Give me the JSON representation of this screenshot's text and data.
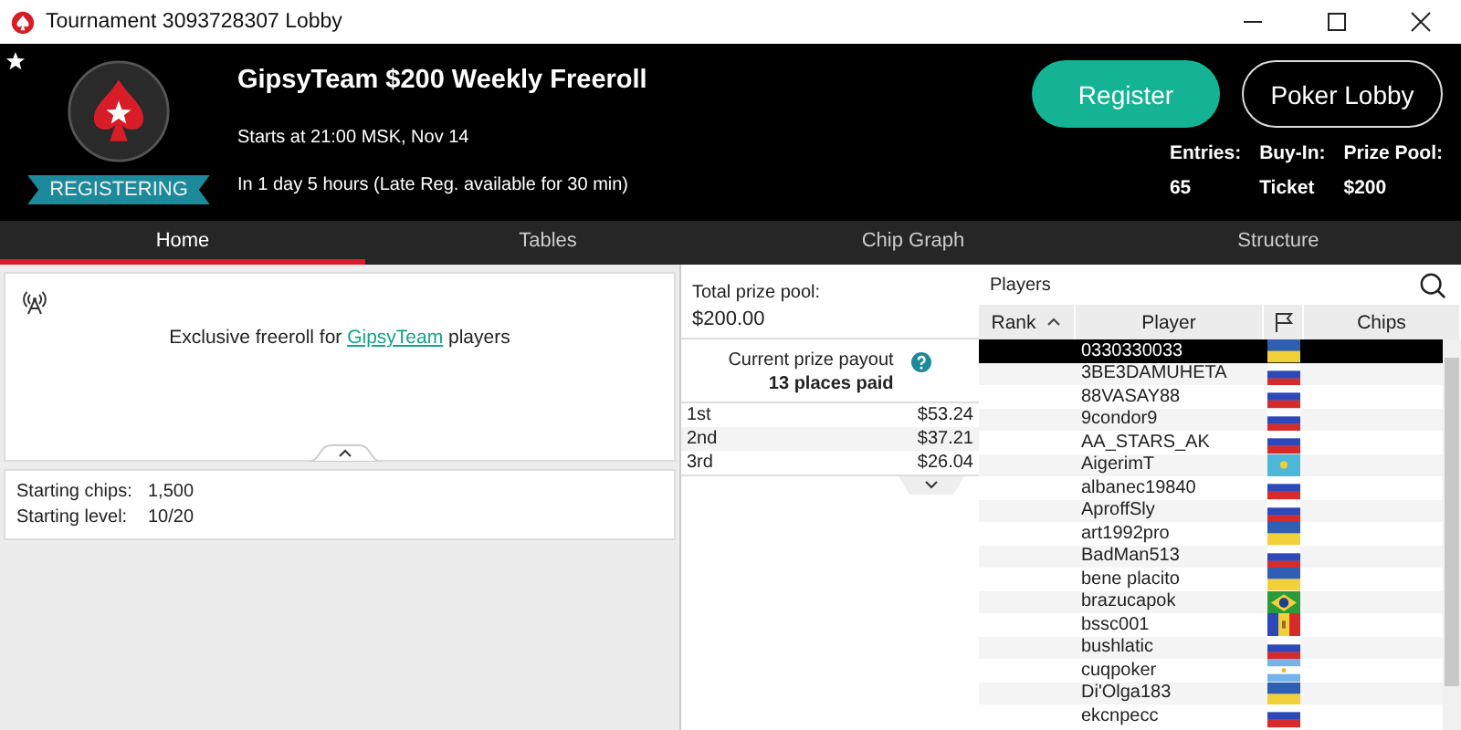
{
  "window": {
    "title": "Tournament 3093728307 Lobby"
  },
  "header": {
    "status": "REGISTERING",
    "title": "GipsyTeam $200 Weekly Freeroll",
    "starts": "Starts at 21:00 MSK, Nov 14",
    "countdown": "In 1 day 5 hours (Late Reg. available for 30 min)",
    "buttons": [
      {
        "label": "Register",
        "kind": "primary"
      },
      {
        "label": "Poker Lobby",
        "kind": "outline"
      }
    ],
    "stats": [
      {
        "label": "Entries:",
        "value": "65"
      },
      {
        "label": "Buy-In:",
        "value": "Ticket"
      },
      {
        "label": "Prize Pool:",
        "value": "$200"
      }
    ]
  },
  "tabs": [
    {
      "label": "Home",
      "selected": true
    },
    {
      "label": "Tables",
      "selected": false
    },
    {
      "label": "Chip Graph",
      "selected": false
    },
    {
      "label": "Structure",
      "selected": false
    }
  ],
  "info": {
    "before": "Exclusive freeroll for",
    "link": "GipsyTeam",
    "after": "players"
  },
  "details": [
    {
      "label": "Starting chips:",
      "value": "1,500"
    },
    {
      "label": "Starting level:",
      "value": "10/20"
    }
  ],
  "prize": {
    "total_label": "Total prize pool:",
    "total": "$200.00",
    "payout_label": "Current prize payout",
    "places": "13 places paid",
    "rows": [
      {
        "place": "1st",
        "amount": "$53.24"
      },
      {
        "place": "2nd",
        "amount": "$37.21"
      },
      {
        "place": "3rd",
        "amount": "$26.04"
      }
    ]
  },
  "players": {
    "title": "Players",
    "columns": [
      "Rank",
      "Player",
      "Chips"
    ],
    "rows": [
      {
        "name": "0330330033",
        "kind": "ua",
        "selected": true
      },
      {
        "name": "3BE3DAMUHETA",
        "kind": "ru",
        "selected": false
      },
      {
        "name": "88VASAY88",
        "kind": "ru",
        "selected": false
      },
      {
        "name": "9condor9",
        "kind": "ru",
        "selected": false
      },
      {
        "name": "AA_STARS_AK",
        "kind": "ru",
        "selected": false
      },
      {
        "name": "AigerimT",
        "kind": "kz",
        "selected": false
      },
      {
        "name": "albanec19840",
        "kind": "ru",
        "selected": false
      },
      {
        "name": "AproffSly",
        "kind": "ru",
        "selected": false
      },
      {
        "name": "art1992pro",
        "kind": "ua",
        "selected": false
      },
      {
        "name": "BadMan513",
        "kind": "ru",
        "selected": false
      },
      {
        "name": "bene placito",
        "kind": "ua",
        "selected": false
      },
      {
        "name": "brazucapok",
        "kind": "br",
        "selected": false
      },
      {
        "name": "bssc001",
        "kind": "md",
        "selected": false
      },
      {
        "name": "bushlatic",
        "kind": "ru",
        "selected": false
      },
      {
        "name": "cuqpoker",
        "kind": "ar",
        "selected": false
      },
      {
        "name": "Di'Olga183",
        "kind": "ua",
        "selected": false
      },
      {
        "name": "ekcnpecc",
        "kind": "ru",
        "selected": false
      }
    ]
  }
}
